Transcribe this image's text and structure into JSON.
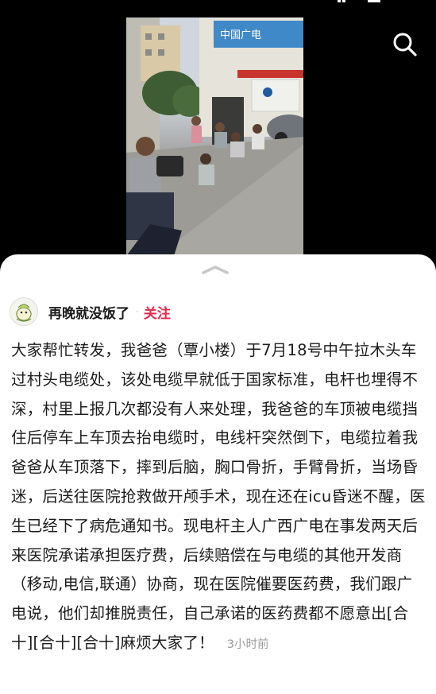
{
  "post": {
    "author": "再晚就没饭了",
    "separator": "·",
    "follow_label": "关注",
    "text": "大家帮忙转发，我爸爸（覃小楼）于7月18号中午拉木头车过村头电缆处，该处电缆早就低于国家标准，电杆也埋得不深，村里上报几次都没有人来处理，我爸爸的车顶被电缆挡住后停车上车顶去抬电缆时，电线杆突然倒下，电缆拉着我爸爸从车顶落下，摔到后脑，胸口骨折，手臂骨折，当场昏迷，后送往医院抢救做开颅手术，现在还在icu昏迷不醒，医生已经下了病危通知书。现电杆主人广西广电在事发两天后来医院承诺承担医疗费，后续赔偿在与电缆的其他开发商（移动,电信,联通）协商，现在医院催要医药费，我们跟广电说，他们却推脱责任，自己承诺的医药费都不愿意出[合十][合十][合十]麻烦大家了！",
    "time": "3小时前"
  },
  "photo_sign": "中国广电",
  "colors": {
    "follow": "#e6274a",
    "background_top": "#000000",
    "sheet": "#ffffff"
  },
  "icons": {
    "search": "search-icon",
    "handle": "chevron-up-icon",
    "avatar": "avatar-cartoon"
  }
}
